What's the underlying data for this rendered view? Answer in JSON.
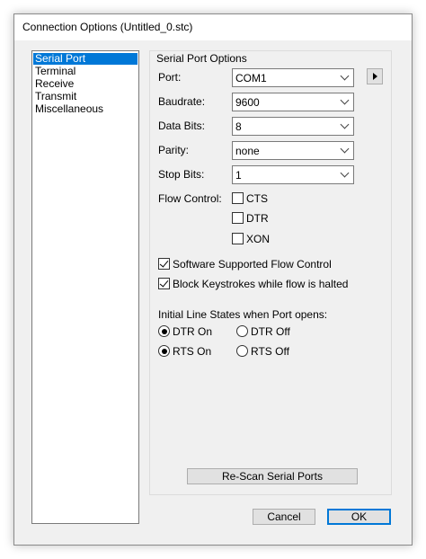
{
  "window": {
    "title": "Connection Options (Untitled_0.stc)"
  },
  "nav": {
    "items": [
      "Serial Port",
      "Terminal",
      "Receive",
      "Transmit",
      "Miscellaneous"
    ],
    "selected": "Serial Port"
  },
  "group": {
    "title": "Serial Port Options"
  },
  "fields": {
    "port": {
      "label": "Port:",
      "value": "COM1"
    },
    "baudrate": {
      "label": "Baudrate:",
      "value": "9600"
    },
    "databits": {
      "label": "Data Bits:",
      "value": "8"
    },
    "parity": {
      "label": "Parity:",
      "value": "none"
    },
    "stopbits": {
      "label": "Stop Bits:",
      "value": "1"
    }
  },
  "flow": {
    "label": "Flow Control:",
    "cts": {
      "label": "CTS",
      "checked": false
    },
    "dtr": {
      "label": "DTR",
      "checked": false
    },
    "xon": {
      "label": "XON",
      "checked": false
    }
  },
  "options": {
    "software_flow": {
      "label": "Software Supported Flow Control",
      "checked": true
    },
    "block_keystrokes": {
      "label": "Block Keystrokes while flow is halted",
      "checked": true
    }
  },
  "line_states": {
    "label": "Initial Line States when Port opens:",
    "dtr_on": {
      "label": "DTR On",
      "selected": true
    },
    "dtr_off": {
      "label": "DTR Off",
      "selected": false
    },
    "rts_on": {
      "label": "RTS On",
      "selected": true
    },
    "rts_off": {
      "label": "RTS Off",
      "selected": false
    }
  },
  "buttons": {
    "rescan": "Re-Scan Serial Ports",
    "cancel": "Cancel",
    "ok": "OK"
  },
  "colors": {
    "selection": "#0078d7",
    "dialog_bg": "#f0f0f0"
  }
}
